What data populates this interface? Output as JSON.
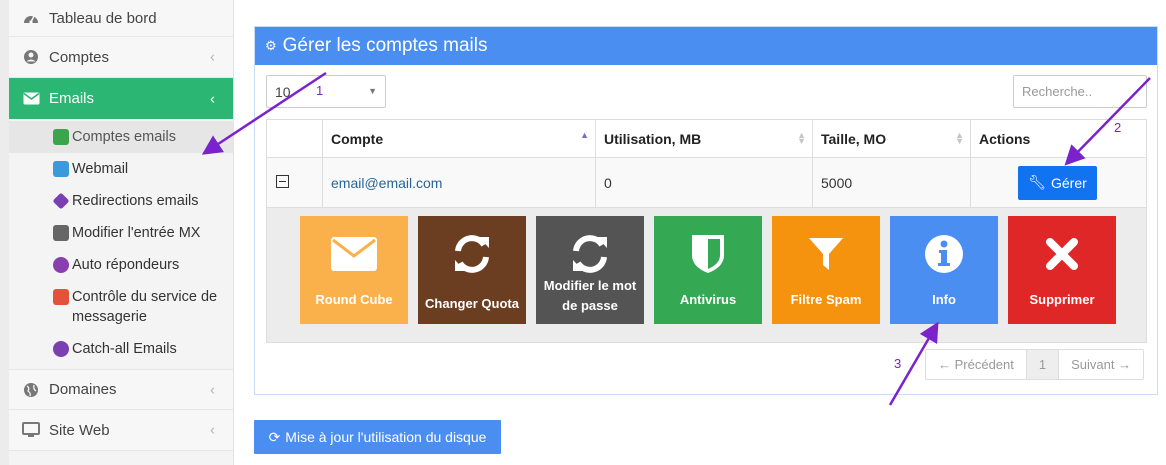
{
  "sidebar": {
    "items": [
      {
        "label": "Tableau de bord",
        "icon": "dashboard-icon"
      },
      {
        "label": "Comptes",
        "icon": "account-icon"
      },
      {
        "label": "Emails",
        "icon": "envelope-icon"
      },
      {
        "label": "Domaines",
        "icon": "globe-icon"
      },
      {
        "label": "Site Web",
        "icon": "monitor-icon"
      }
    ],
    "email_submenu": [
      {
        "label": "Comptes emails",
        "color": "#3aa54a"
      },
      {
        "label": "Webmail",
        "color": "#3b9ad9"
      },
      {
        "label": "Redirections emails",
        "color": "#7a3fb0"
      },
      {
        "label": "Modifier l'entrée MX",
        "color": "#666666"
      },
      {
        "label": "Auto répondeurs",
        "color": "#8a3fb0"
      },
      {
        "label": "Contrôle du service de messagerie",
        "color": "#e2543a"
      },
      {
        "label": "Catch-all Emails",
        "color": "#7a3fb0"
      }
    ]
  },
  "panel": {
    "title": "Gérer les comptes mails",
    "page_length": "10",
    "search_placeholder": "Recherche..",
    "columns": [
      "Compte",
      "Utilisation, MB",
      "Taille, MO",
      "Actions"
    ],
    "rows": [
      {
        "account": "email@email.com",
        "usage": "0",
        "size": "5000",
        "action_label": "Gérer"
      }
    ],
    "tiles": [
      {
        "label": "Round Cube",
        "color": "#fbb14b",
        "icon": "envelope-icon"
      },
      {
        "label": "Changer Quota",
        "color": "#6b3e22",
        "icon": "refresh-icon"
      },
      {
        "label": "Modifier le mot de passe",
        "color": "#545454",
        "icon": "refresh-icon"
      },
      {
        "label": "Antivirus",
        "color": "#34a853",
        "icon": "shield-icon"
      },
      {
        "label": "Filtre Spam",
        "color": "#f5920e",
        "icon": "filter-icon"
      },
      {
        "label": "Info",
        "color": "#4b8ef1",
        "icon": "info-icon"
      },
      {
        "label": "Supprimer",
        "color": "#e02727",
        "icon": "close-icon"
      }
    ],
    "pagination": {
      "previous": "← Précédent",
      "current": "1",
      "next": "Suivant →"
    }
  },
  "update_button": "Mise à jour l'utilisation du disque",
  "annotations": [
    "1",
    "2",
    "3"
  ],
  "colors": {
    "accent": "#4b8ef1",
    "active_nav": "#2bb673",
    "arrow": "#7a22cc"
  }
}
